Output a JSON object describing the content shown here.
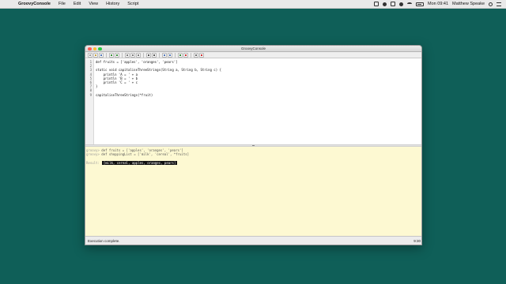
{
  "menubar": {
    "apple_icon": "apple-logo-icon",
    "app_name": "GroovyConsole",
    "items": [
      "File",
      "Edit",
      "View",
      "History",
      "Script"
    ],
    "clock": "Mon 09:41",
    "user": "Matthew Speake"
  },
  "window": {
    "title": "GroovyConsole"
  },
  "toolbar": {
    "buttons": [
      "new-file-icon",
      "open-icon",
      "save-icon",
      "undo-icon",
      "redo-icon",
      "cut-icon",
      "copy-icon",
      "paste-icon",
      "find-icon",
      "replace-icon",
      "history-prev-icon",
      "history-next-icon",
      "run-icon",
      "interrupt-icon",
      "inspect-icon",
      "clear-icon"
    ]
  },
  "editor": {
    "line_numbers": [
      "1",
      "2",
      "3",
      "4",
      "5",
      "6",
      "7",
      "8",
      "9"
    ],
    "lines": [
      "def fruits = ['apples', 'oranges', 'pears']",
      "",
      "static void capitaliseThreeStrings(String a, String b, String c) {",
      "    println 'A = ' + a",
      "    println 'B = ' + b",
      "    println 'C = ' + c",
      "}",
      "",
      "capitaliseThreeStrings(*fruit)"
    ]
  },
  "output": {
    "prompt": "groovy>",
    "lines": [
      "def fruits = ['apples', 'oranges', 'pears']",
      "def shoppingList = ['milk', 'cereal', *fruits]"
    ],
    "result_label": "Result:",
    "result_value": "[milk, cereal, apples, oranges, pears]"
  },
  "statusbar": {
    "message": "Execution complete.",
    "position": "9:30"
  },
  "colors": {
    "desktop": "#0f5f58",
    "output_bg": "#fdf9d2",
    "close": "#fc5f57",
    "minimize": "#fdbc2e",
    "maximize": "#28c840"
  }
}
